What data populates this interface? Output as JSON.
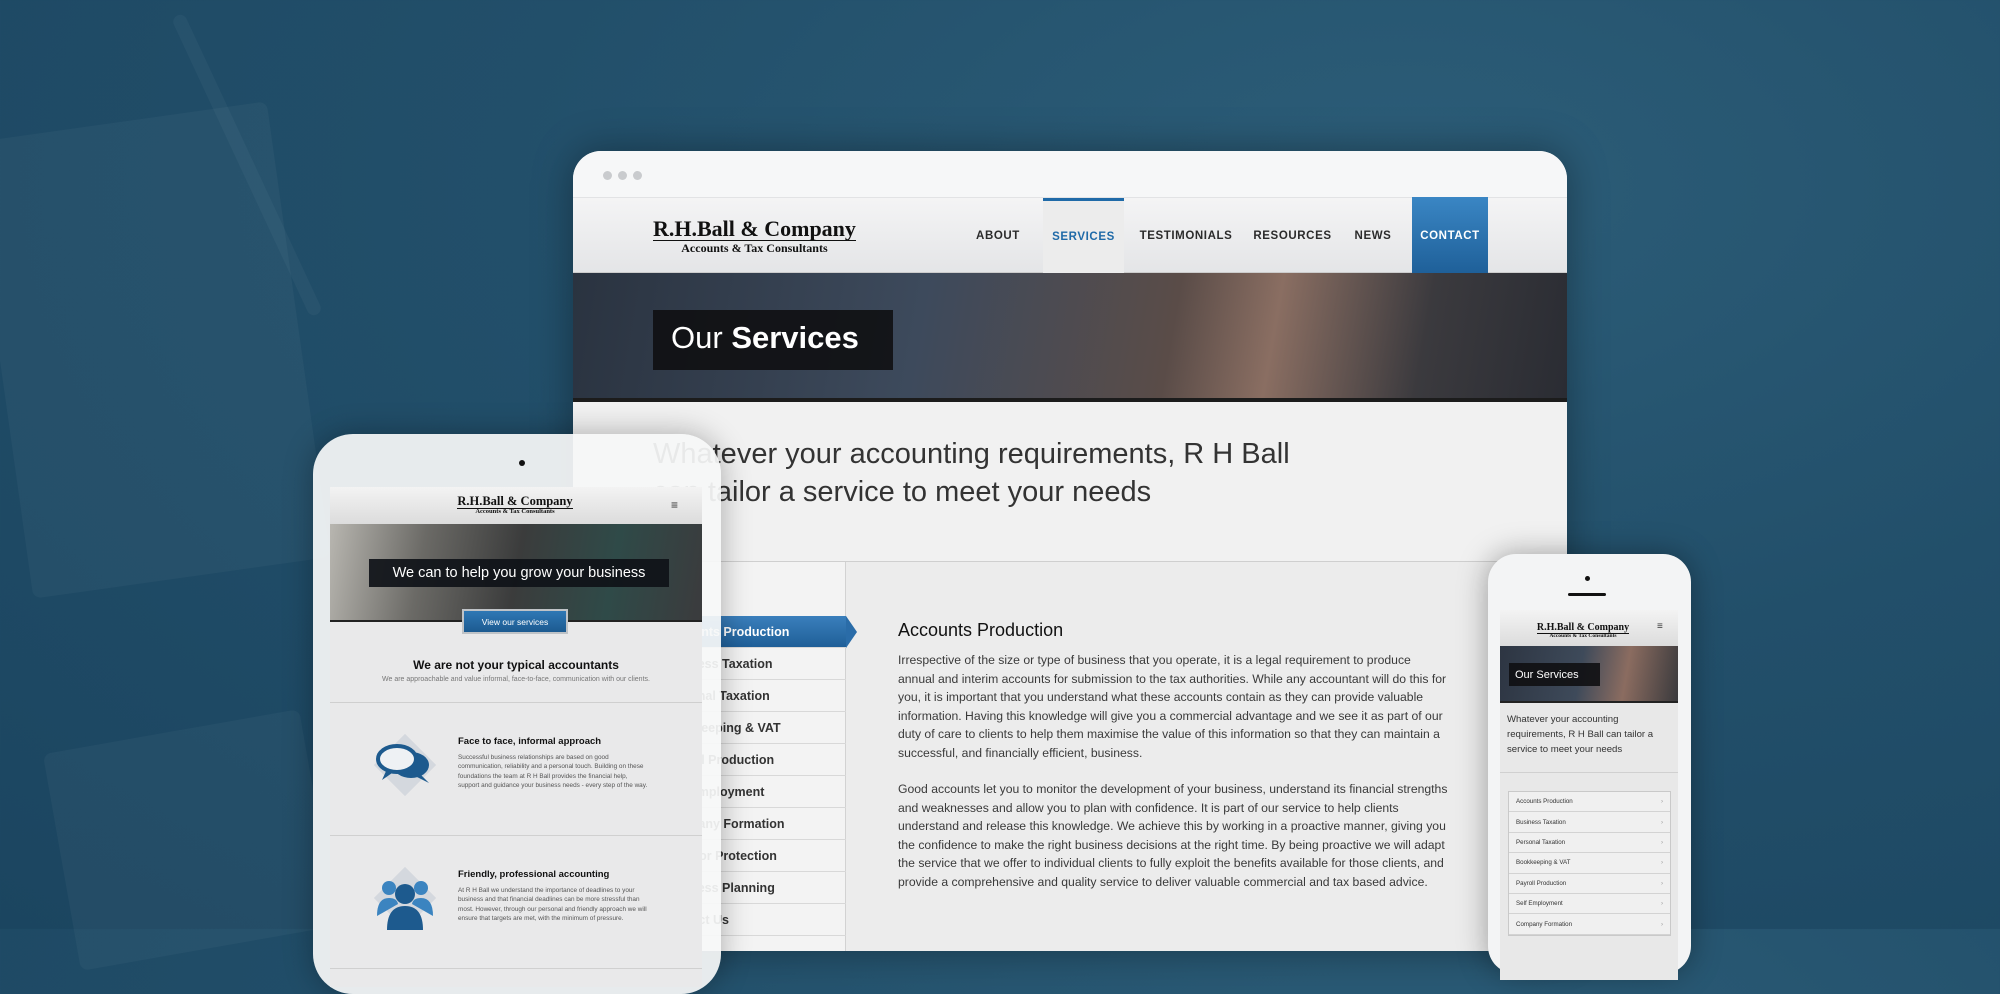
{
  "brand": {
    "name": "R.H.Ball & Company",
    "tagline": "Accounts & Tax Consultants"
  },
  "desktop": {
    "nav": [
      "ABOUT",
      "SERVICES",
      "TESTIMONIALS",
      "RESOURCES",
      "NEWS",
      "CONTACT"
    ],
    "active_nav": "SERVICES",
    "hero_title_light": "Our",
    "hero_title_bold": "Services",
    "intro_line1": "Whatever your accounting requirements, R H Ball",
    "intro_line2": "can tailor a service to meet your needs",
    "sidebar": [
      "Accounts Production",
      "Business Taxation",
      "Personal Taxation",
      "Bookkeeping & VAT",
      "Payroll Production",
      "Self Employment",
      "Company Formation",
      "Investor Protection",
      "Business Planning",
      "Contact Us"
    ],
    "article": {
      "title": "Accounts Production",
      "paragraphs": [
        "Irrespective of the size or type of business that you operate, it is a legal requirement to produce annual and interim accounts for submission to the tax authorities. While any accountant will do this for you, it is important that you understand what these accounts contain as they can provide valuable information. Having this knowledge will give you a commercial advantage and we see it as part of our duty of care to clients to help them maximise the value of this information so that they can maintain a successful, and financially efficient, business.",
        "Good accounts let you to monitor the development of your business, understand its financial strengths and weaknesses and allow you to plan with confidence. It is part of our service to help clients understand and release this knowledge. We achieve this by working in a proactive manner, giving you the confidence to make the right business decisions at the right time. By being proactive we will adapt the service that we offer to individual clients to fully exploit the benefits available for those clients, and provide a comprehensive and quality service to deliver valuable commercial and tax based advice."
      ]
    }
  },
  "tablet": {
    "hero_light": "We can to help you",
    "hero_bold": "grow your business",
    "button": "View our services",
    "section_title": "We are not your typical accountants",
    "section_sub": "We are approachable and value informal, face-to-face, communication with our clients.",
    "features": [
      {
        "icon": "speech-bubbles-icon",
        "title": "Face to face, informal approach",
        "text": "Successful business relationships are based on good communication, reliability and a personal touch. Building on these foundations the team at R H Ball provides the financial help, support and guidance your business needs - every step of the way."
      },
      {
        "icon": "people-icon",
        "title": "Friendly, professional accounting",
        "text": "At R H Ball we understand the importance of deadlines to your business and that financial deadlines can be more stressful than most. However, through our personal and friendly approach we will ensure that targets are met, with the minimum of pressure."
      }
    ]
  },
  "phone": {
    "hero": "Our Services",
    "intro": "Whatever your accounting requirements, R H Ball can tailor a service to meet your needs",
    "list": [
      "Accounts Production",
      "Business Taxation",
      "Personal Taxation",
      "Bookkeeping & VAT",
      "Payroll Production",
      "Self Employment",
      "Company Formation"
    ],
    "chevron": "›"
  },
  "colors": {
    "accent": "#1f6aa8",
    "background": "#224f6a"
  }
}
